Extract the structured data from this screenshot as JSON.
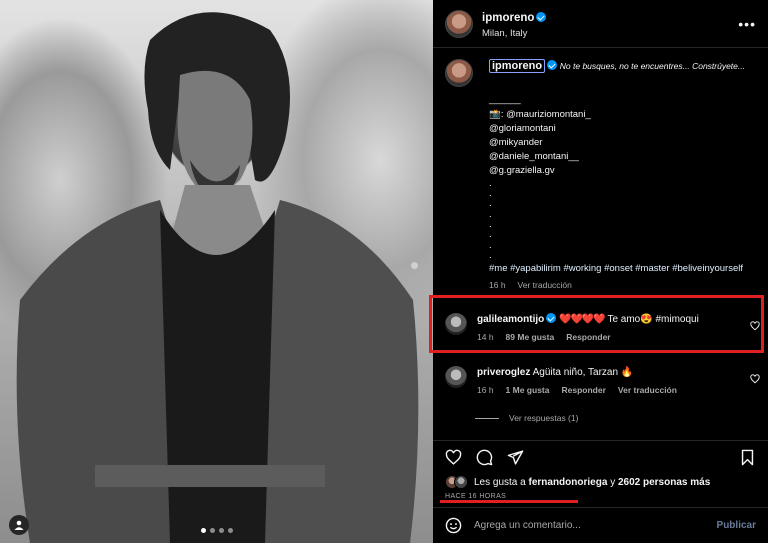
{
  "post": {
    "username": "ipmoreno",
    "location": "Milan, Italy"
  },
  "caption": {
    "username": "ipmoreno",
    "text": "No te busques, no te encuentres... Constrúyete...",
    "divider": "______",
    "credits": [
      "📸: @mauriziomontani_",
      "@gloriamontani",
      "@mikyander",
      "@daniele_montani__",
      "@g.graziella.gv"
    ],
    "dots": [
      ".",
      ".",
      ".",
      ".",
      ".",
      ".",
      ".",
      "."
    ],
    "hashtags": "#me #yapabilirim #working #onset #master #beliveinyourself",
    "time": "16 h",
    "translate": "Ver traducción"
  },
  "comments": [
    {
      "username": "galileamontijo",
      "hearts": "❤️❤️❤️❤️",
      "text": "Te amo😍 #mimoqui",
      "time": "14 h",
      "likes": "89 Me gusta",
      "reply": "Responder"
    },
    {
      "username": "priveroglez",
      "text": "Agüita niño, Tarzan 🔥",
      "time": "16 h",
      "likes": "1 Me gusta",
      "reply": "Responder",
      "translate": "Ver traducción",
      "view_replies": "Ver respuestas (1)"
    }
  ],
  "likes_line": {
    "prefix": "Les gusta a",
    "user": "fernandonoriega",
    "middle": "y",
    "count": "2602 personas más"
  },
  "time_ago": "HACE 16 HORAS",
  "add_comment": {
    "placeholder": "Agrega un comentario...",
    "publish": "Publicar"
  },
  "colors": {
    "highlight": "#e02020",
    "verified": "#0095f6",
    "hearts": "#ff2a3d"
  }
}
